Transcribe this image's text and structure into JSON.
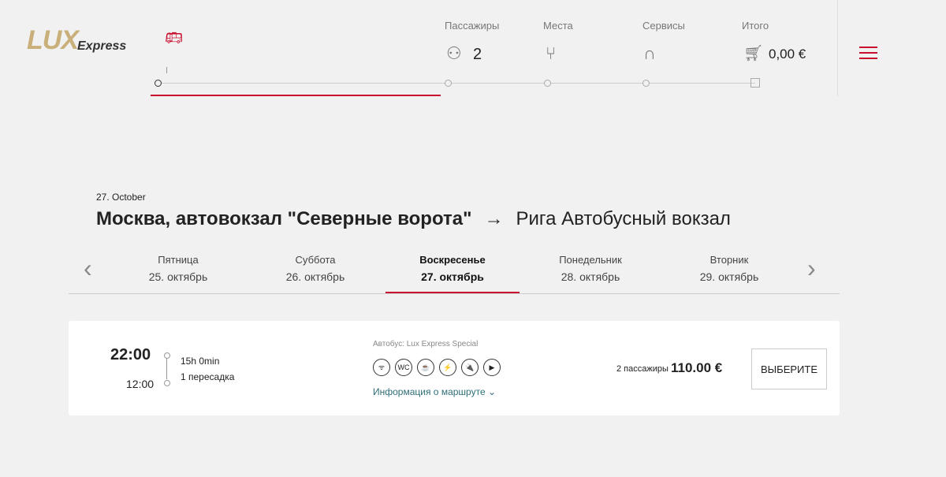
{
  "header": {
    "logo_text": "LUX Express",
    "steps": [
      {
        "label": "Пассажиры",
        "value": "2",
        "icon": "person-icon"
      },
      {
        "label": "Места",
        "icon": "seat-icon"
      },
      {
        "label": "Сервисы",
        "icon": "headphones-icon"
      },
      {
        "label": "Итого",
        "value": "0,00 €",
        "icon": "cart-icon"
      }
    ]
  },
  "search": {
    "date": "27. October",
    "from": "Москва, автовокзал \"Северные ворота\"",
    "to": "Рига Автобусный вокзал"
  },
  "days": [
    {
      "name": "Пятница",
      "date": "25. октябрь"
    },
    {
      "name": "Суббота",
      "date": "26. октябрь"
    },
    {
      "name": "Воскресенье",
      "date": "27. октябрь",
      "active": true
    },
    {
      "name": "Понедельник",
      "date": "28. октябрь"
    },
    {
      "name": "Вторник",
      "date": "29. октябрь"
    }
  ],
  "trip": {
    "departure": "22:00",
    "arrival": "12:00",
    "duration": "15h 0min",
    "transfers": "1 пересадка",
    "bus": "Автобус: Lux Express Special",
    "amenities": [
      "ᯤ",
      "WC",
      "☕",
      "⚡",
      "🔌",
      "▶"
    ],
    "route_info": "Информация о маршруте",
    "passengers": "2 пассажиры",
    "price": "110.00 €",
    "select": "ВЫБЕРИТЕ"
  }
}
